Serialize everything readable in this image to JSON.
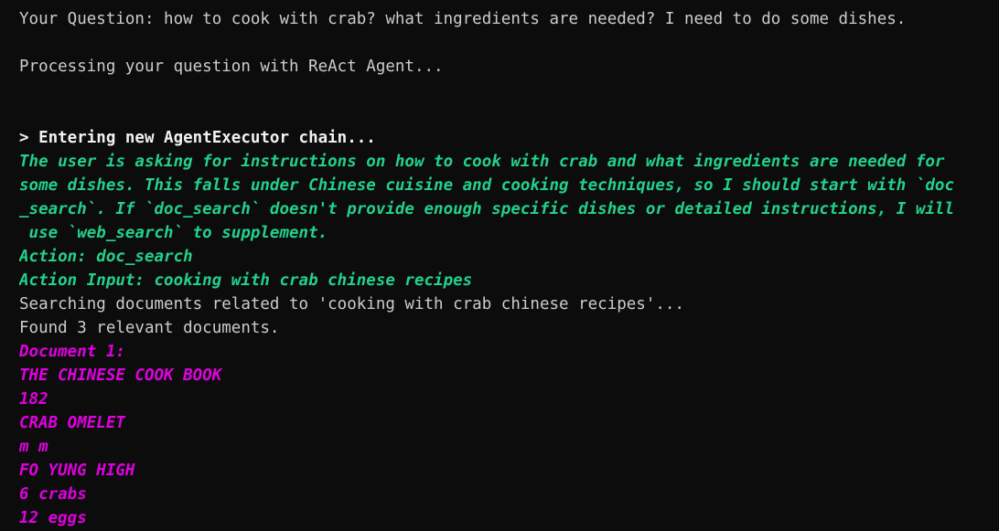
{
  "prompt_line": "Your Question: how to cook with crab? what ingredients are needed? I need to do some dishes.",
  "processing_line": "Processing your question with ReAct Agent...",
  "chain_header": "> Entering new AgentExecutor chain...",
  "thought_lines": [
    "The user is asking for instructions on how to cook with crab and what ingredients are needed for",
    "some dishes. This falls under Chinese cuisine and cooking techniques, so I should start with `doc",
    "_search`. If `doc_search` doesn't provide enough specific dishes or detailed instructions, I will",
    " use `web_search` to supplement."
  ],
  "action_line": "Action: doc_search",
  "action_input_line": "Action Input: cooking with crab chinese recipes",
  "searching_line": "Searching documents related to 'cooking with crab chinese recipes'...",
  "found_line": "Found 3 relevant documents.",
  "document_lines": [
    "Document 1:",
    "THE CHINESE COOK BOOK",
    "182",
    "CRAB OMELET",
    "m m",
    "FO YUNG HIGH",
    "6 crabs",
    "12 eggs"
  ],
  "colors": {
    "background": "#0c0c0c",
    "text": "#cccccc",
    "agent_green": "#23d18b",
    "document_magenta": "#e100e1"
  }
}
